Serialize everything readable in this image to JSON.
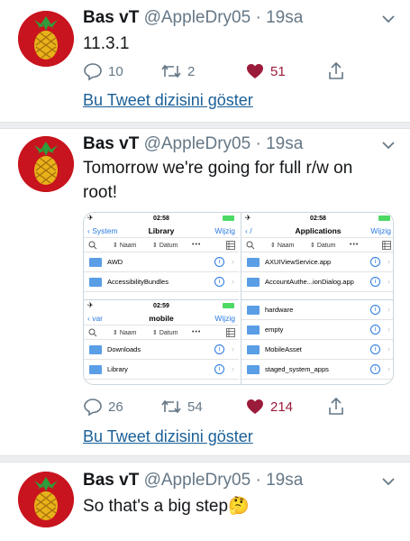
{
  "colors": {
    "link": "#1a5f97",
    "heart": "#9b1b3a",
    "muted": "#657786"
  },
  "tweets": [
    {
      "name": "Bas vT",
      "handle": "@AppleDry05",
      "time": "19sa",
      "text": "11.3.1",
      "replies": "10",
      "retweets": "2",
      "likes": "51",
      "show_thread": "Bu Tweet dizisini göster"
    },
    {
      "name": "Bas vT",
      "handle": "@AppleDry05",
      "time": "19sa",
      "text": "Tomorrow we're going for full r/w on root!",
      "replies": "26",
      "retweets": "54",
      "likes": "214",
      "show_thread": "Bu Tweet dizisini göster"
    },
    {
      "name": "Bas vT",
      "handle": "@AppleDry05",
      "time": "19sa",
      "text": "So that's a big step🤔"
    }
  ],
  "media": {
    "p1": {
      "time": "02:58",
      "back": "System",
      "title": "Library",
      "right": "Wijzig",
      "col1": "Naam",
      "col2": "Datum",
      "rows": [
        "AWD",
        "AccessibilityBundles"
      ]
    },
    "p2": {
      "time": "02:58",
      "back": "/",
      "title": "Applications",
      "right": "Wijzig",
      "col1": "Naam",
      "col2": "Datum",
      "rows": [
        "AXUIViewService.app",
        "AccountAuthe...ionDialog.app"
      ]
    },
    "p3": {
      "time": "02:59",
      "back": "var",
      "title": "mobile",
      "right": "Wijzig",
      "col1": "Naam",
      "col2": "Datum",
      "rows": [
        "Downloads",
        "Library"
      ]
    },
    "p4": {
      "rows": [
        "hardware",
        "empty",
        "MobileAsset",
        "staged_system_apps"
      ]
    }
  }
}
